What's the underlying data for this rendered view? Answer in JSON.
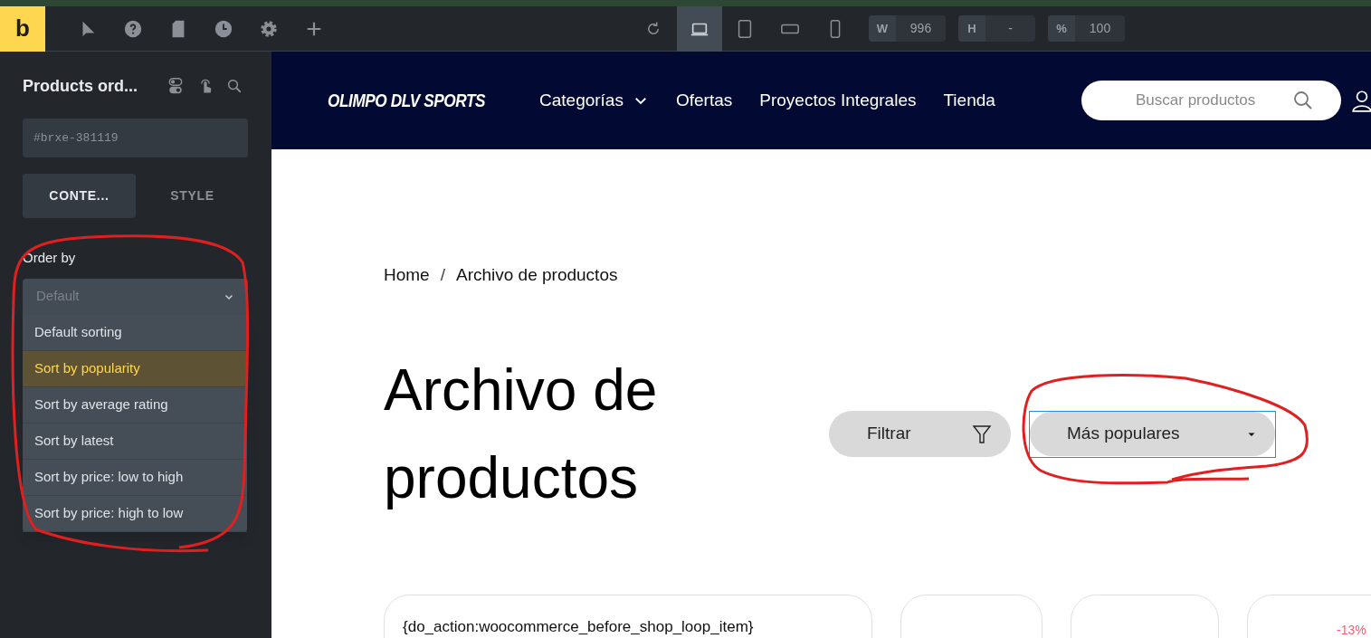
{
  "toolbar": {
    "logo": "b",
    "tools": [
      {
        "kind": "pointer"
      },
      {
        "kind": "help"
      },
      {
        "kind": "page"
      },
      {
        "kind": "history"
      },
      {
        "kind": "settings"
      },
      {
        "kind": "add"
      }
    ],
    "devices": [
      {
        "kind": "desktop",
        "selected": true
      },
      {
        "kind": "tablet",
        "selected": false
      },
      {
        "kind": "landscape",
        "selected": false
      },
      {
        "kind": "phone",
        "selected": false
      }
    ],
    "fields": [
      {
        "label": "W",
        "value": "996"
      },
      {
        "label": "H",
        "value": "-"
      },
      {
        "label": "%",
        "value": "100"
      }
    ]
  },
  "panel": {
    "title": "Products ord...",
    "element_id": "#brxe-381119",
    "tabs": [
      {
        "label": "CONTE...",
        "selected": true
      },
      {
        "label": "STYLE",
        "selected": false
      }
    ],
    "order_by": {
      "label": "Order by",
      "placeholder": "Default",
      "options": [
        {
          "label": "Default sorting",
          "selected": false
        },
        {
          "label": "Sort by popularity",
          "selected": true
        },
        {
          "label": "Sort by average rating",
          "selected": false
        },
        {
          "label": "Sort by latest",
          "selected": false
        },
        {
          "label": "Sort by price: low to high",
          "selected": false
        },
        {
          "label": "Sort by price: high to low",
          "selected": false
        }
      ]
    }
  },
  "site": {
    "logo": "OLIMPO DLV SPORTS",
    "nav": [
      {
        "label": "Categorías",
        "dropdown": true
      },
      {
        "label": "Ofertas",
        "dropdown": false
      },
      {
        "label": "Proyectos Integrales",
        "dropdown": false
      },
      {
        "label": "Tienda",
        "dropdown": false
      }
    ],
    "search": {
      "placeholder": "Buscar productos"
    },
    "breadcrumb": [
      "Home",
      "Archivo de productos"
    ],
    "breadcrumb_separator": "/",
    "heading": "Archivo de productos",
    "filter_button": "Filtrar",
    "sort_select": "Más populares",
    "cards": [
      {
        "kind": "text",
        "text": "{do_action:woocommerce_before_shop_loop_item}"
      },
      {
        "kind": "blank"
      },
      {
        "kind": "blank"
      },
      {
        "kind": "badge",
        "badge": "-13%"
      }
    ]
  }
}
